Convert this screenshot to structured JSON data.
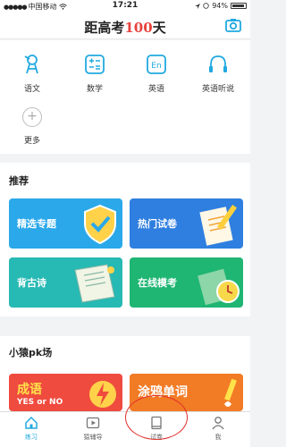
{
  "status": {
    "carrier": "中国移动",
    "time": "17:21",
    "battery": "94%"
  },
  "header": {
    "title_prefix": "距高考",
    "title_number": "100",
    "title_suffix": "天"
  },
  "subjects": [
    {
      "label": "语文",
      "icon": "chinese-icon"
    },
    {
      "label": "数学",
      "icon": "math-icon"
    },
    {
      "label": "英语",
      "icon": "english-icon"
    },
    {
      "label": "英语听说",
      "icon": "headphones-icon"
    },
    {
      "label": "更多",
      "icon": "plus-icon"
    }
  ],
  "recommend": {
    "title": "推荐",
    "cards": [
      {
        "label": "精选专题",
        "color": "#2aa8ea"
      },
      {
        "label": "热门试卷",
        "color": "#2f7fe0"
      },
      {
        "label": "背古诗",
        "color": "#27b9b4"
      },
      {
        "label": "在线模考",
        "color": "#1fb573"
      }
    ]
  },
  "pk": {
    "title": "小猿pk场",
    "cards": [
      {
        "label": "成语",
        "sub": "YES or NO",
        "color": "#ef4b3e"
      },
      {
        "label": "涂鸦单词",
        "color": "#f27b26"
      }
    ]
  },
  "nav": [
    {
      "label": "练习",
      "icon": "home-icon",
      "active": true
    },
    {
      "label": "猿辅导",
      "icon": "video-icon",
      "active": false
    },
    {
      "label": "试卷",
      "icon": "exam-paper-icon",
      "active": false
    },
    {
      "label": "我",
      "icon": "user-icon",
      "active": false
    }
  ]
}
